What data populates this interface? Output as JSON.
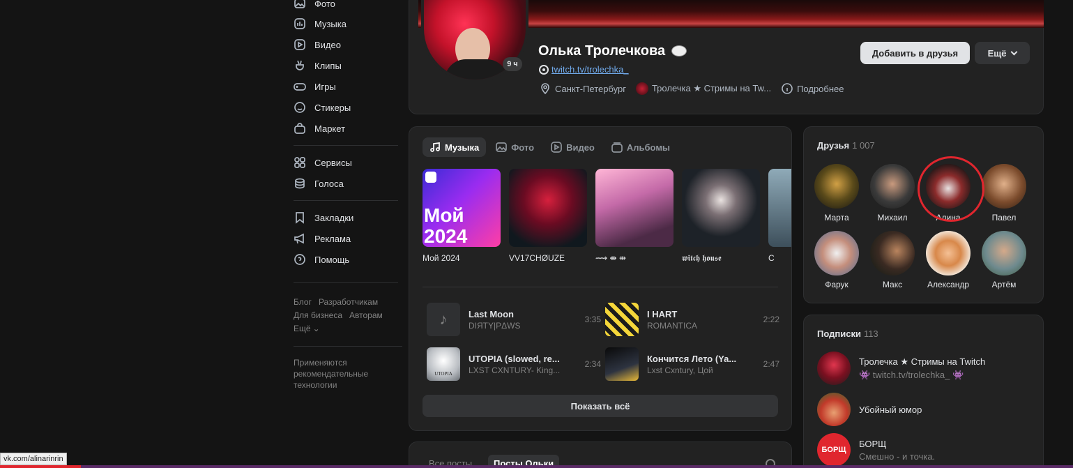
{
  "nav": {
    "items": [
      {
        "label": "Фото",
        "icon": "photo-icon"
      },
      {
        "label": "Музыка",
        "icon": "music-icon"
      },
      {
        "label": "Видео",
        "icon": "video-icon"
      },
      {
        "label": "Клипы",
        "icon": "clips-icon"
      },
      {
        "label": "Игры",
        "icon": "gamepad-icon"
      },
      {
        "label": "Стикеры",
        "icon": "smile-icon"
      },
      {
        "label": "Маркет",
        "icon": "bag-icon"
      },
      {
        "label": "Сервисы",
        "icon": "grid-icon"
      },
      {
        "label": "Голоса",
        "icon": "coins-icon"
      },
      {
        "label": "Закладки",
        "icon": "bookmark-icon"
      },
      {
        "label": "Реклама",
        "icon": "megaphone-icon"
      },
      {
        "label": "Помощь",
        "icon": "help-icon"
      }
    ],
    "footer_links": [
      "Блог",
      "Разработчикам",
      "Для бизнеса",
      "Авторам",
      "Ещё"
    ],
    "footer_note": "Применяются рекомендательные технологии"
  },
  "profile": {
    "name": "Олька Тролечкова",
    "online_badge": "9 ч",
    "status_link": "twitch.tv/trolechka_",
    "city": "Санкт-Петербург",
    "community": "Тролечка ★ Стримы на Tw...",
    "details": "Подробнее",
    "add_friend": "Добавить в друзья",
    "more": "Ещё"
  },
  "media": {
    "tabs": [
      {
        "label": "Музыка",
        "icon": "music-note-icon",
        "active": true
      },
      {
        "label": "Фото",
        "icon": "photo-icon",
        "active": false
      },
      {
        "label": "Видео",
        "icon": "video-icon",
        "active": false
      },
      {
        "label": "Альбомы",
        "icon": "albums-icon",
        "active": false
      }
    ],
    "albums": [
      {
        "caption": "Мой 2024",
        "cover_text": "Мой 2024"
      },
      {
        "caption": "VV17CHØUZE"
      },
      {
        "caption": "⟿ ⇼ ⇻"
      },
      {
        "caption": "𝖜𝖎𝖙𝖈𝖍 𝖍𝖔𝖚𝖘𝖊"
      },
      {
        "caption": "C"
      }
    ],
    "tracks": [
      {
        "title": "Last Moon",
        "artist": "DIЯTY|PΔWS",
        "duration": "3:35"
      },
      {
        "title": "I HART",
        "artist": "ROMANTICA",
        "duration": "2:22"
      },
      {
        "title": "UTOPIA (slowed, re...",
        "artist": "LXST CXNTURY- King...",
        "duration": "2:34",
        "cover_text": "UTOPIA"
      },
      {
        "title": "Кончится Лето (Ya...",
        "artist": "Lxst Cxntury, Цой",
        "duration": "2:47"
      }
    ],
    "show_all": "Показать всё"
  },
  "friends": {
    "title": "Друзья",
    "count": "1 007",
    "list": [
      "Марта",
      "Михаил",
      "Алина",
      "Павел",
      "Фарук",
      "Макс",
      "Александр",
      "Артём"
    ]
  },
  "subscriptions": {
    "title": "Подписки",
    "count": "113",
    "list": [
      {
        "name": "Тролечка ★ Стримы на Twitch",
        "desc": "👾 twitch.tv/trolechka_ 👾"
      },
      {
        "name": "Убойный юмор",
        "desc": ""
      },
      {
        "name": "БОРЩ",
        "desc": "Смешно - и точка.",
        "avatar_text": "БОРЩ"
      }
    ]
  },
  "posts": {
    "tabs": [
      "Все посты",
      "Посты Ольки"
    ]
  },
  "status_url": "vk.com/alinarinrin",
  "colors": {
    "accent_link": "#71aaeb",
    "highlight_ring": "#e0262e",
    "card_bg": "#222222"
  }
}
